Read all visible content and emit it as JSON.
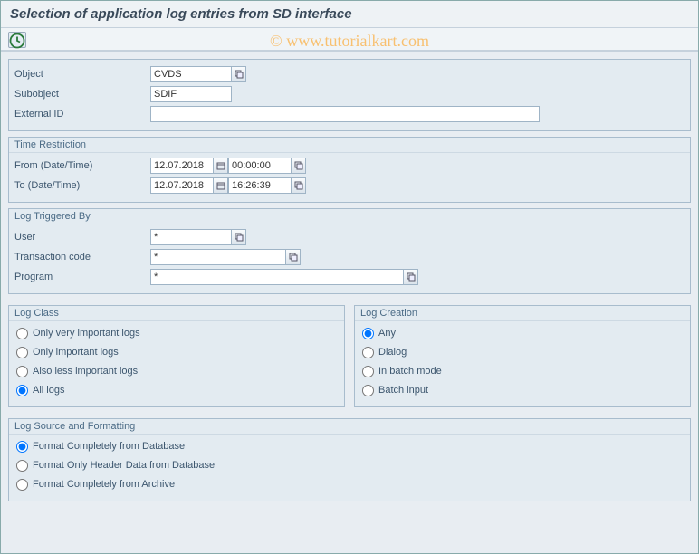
{
  "title": "Selection of application log entries from SD interface",
  "watermark": "© www.tutorialkart.com",
  "fields": {
    "object": {
      "label": "Object",
      "value": "CVDS"
    },
    "subobject": {
      "label": "Subobject",
      "value": "SDIF"
    },
    "external_id": {
      "label": "External ID",
      "value": ""
    }
  },
  "time": {
    "title": "Time Restriction",
    "from_label": "From (Date/Time)",
    "to_label": "To (Date/Time)",
    "from_date": "12.07.2018",
    "from_time": "00:00:00",
    "to_date": "12.07.2018",
    "to_time": "16:26:39"
  },
  "triggered": {
    "title": "Log Triggered By",
    "user": {
      "label": "User",
      "value": "*"
    },
    "tcode": {
      "label": "Transaction code",
      "value": "*"
    },
    "program": {
      "label": "Program",
      "value": "*"
    }
  },
  "log_class": {
    "title": "Log Class",
    "options": [
      "Only very important logs",
      "Only important logs",
      "Also less important logs",
      "All logs"
    ],
    "selected": 3
  },
  "log_creation": {
    "title": "Log Creation",
    "options": [
      "Any",
      "Dialog",
      "In batch mode",
      "Batch input"
    ],
    "selected": 0
  },
  "log_source": {
    "title": "Log Source and Formatting",
    "options": [
      "Format Completely from Database",
      "Format Only Header Data from Database",
      "Format Completely from Archive"
    ],
    "selected": 0
  }
}
